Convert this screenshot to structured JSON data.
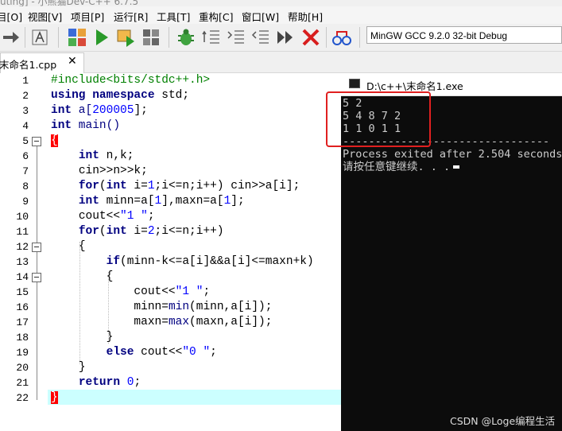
{
  "window": {
    "title_fragment": "uting] - 小熊猫Dev-C++ 6.7.5"
  },
  "menu": [
    "目[O]",
    "视图[V]",
    "项目[P]",
    "运行[R]",
    "工具[T]",
    "重构[C]",
    "窗口[W]",
    "帮助[H]"
  ],
  "toolbar": {
    "compiler": "MinGW GCC 9.2.0 32-bit Debug",
    "icons": [
      "arrow-right-icon",
      "format-icon",
      "compile-icon",
      "run-icon",
      "compile-run-icon",
      "rebuild-icon",
      "debug-icon",
      "indent-icon",
      "unindent-icon",
      "toggle-comment-icon",
      "step-icon",
      "stop-icon",
      "profile-icon"
    ]
  },
  "tab": {
    "label": "末命名1.cpp",
    "close": "✕"
  },
  "gutter": {
    "line_numbers": [
      "1",
      "2",
      "3",
      "4",
      "5",
      "6",
      "7",
      "8",
      "9",
      "10",
      "11",
      "12",
      "13",
      "14",
      "15",
      "16",
      "17",
      "18",
      "19",
      "20",
      "21",
      "22"
    ]
  },
  "code": {
    "l1": "#include<bits/stdc++.h>",
    "using": "using",
    "namespace": "namespace",
    "std": " std;",
    "int": "int",
    "a_decl": " a[",
    "arr_size": "200005",
    "a_decl_end": "];",
    "main": " main()",
    "open_brace": "{",
    "l6_vars": " n,k;",
    "l7": "cin>>n>>k;",
    "for": "for",
    "l8_a": "(",
    "l8_b": " i=",
    "one": "1",
    "l8_c": ";i<=n;i++) cin>>a[i];",
    "l9_a": " minn=a[",
    "l9_b": "],maxn=a[",
    "l9_c": "];",
    "cout": "cout<<",
    "str1": "\"1 \"",
    "semi": ";",
    "two": "2",
    "l12_c": ";i<=n;i++)",
    "if": "if",
    "l14_a": "(minn-k<=a[i]&&a[i]<=maxn+k)",
    "min": "min",
    "max": "max",
    "l17_a": "minn=",
    "l17_b": "(minn,a[i]);",
    "l18_a": "maxn=",
    "l18_b": "(maxn,a[i]);",
    "close_brace": "}",
    "else": "else",
    "str0": "\"0 \"",
    "return": "return",
    "zero": "0",
    "end_brace": "}"
  },
  "console": {
    "title": "D:\\c++\\末命名1.exe",
    "lines": [
      "5 2",
      "5 4 8 7 2",
      "1 1 0 1 1",
      "--------------------------------",
      "Process exited after 2.504 seconds",
      "请按任意键继续. . ."
    ]
  },
  "watermark": "CSDN @Loge编程生活",
  "colors": {
    "keyword": "#000080",
    "number": "#0000ff",
    "preprocessor": "#008000",
    "current_line": "#ccffff",
    "highlight_box": "#e02020",
    "console_bg": "#0c0c0c"
  }
}
